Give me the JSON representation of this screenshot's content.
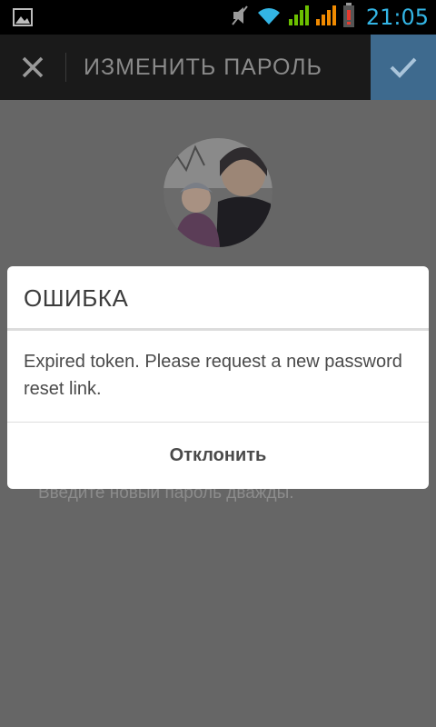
{
  "status_bar": {
    "time": "21:05",
    "icons": [
      "image-notification-icon",
      "mute-icon",
      "wifi-icon",
      "signal-icon",
      "signal-icon-2",
      "battery-low-icon"
    ],
    "time_color": "#33b5e5"
  },
  "action_bar": {
    "title": "ИЗМЕНИТЬ ПАРОЛЬ",
    "close_icon": "close-icon",
    "confirm_icon": "check-icon",
    "confirm_color": "#3e6a8e"
  },
  "background": {
    "hint": "Введите новый пароль дважды."
  },
  "dialog": {
    "title": "ОШИБКА",
    "message": "Expired token. Please request a new password reset link.",
    "button_label": "Отклонить"
  }
}
